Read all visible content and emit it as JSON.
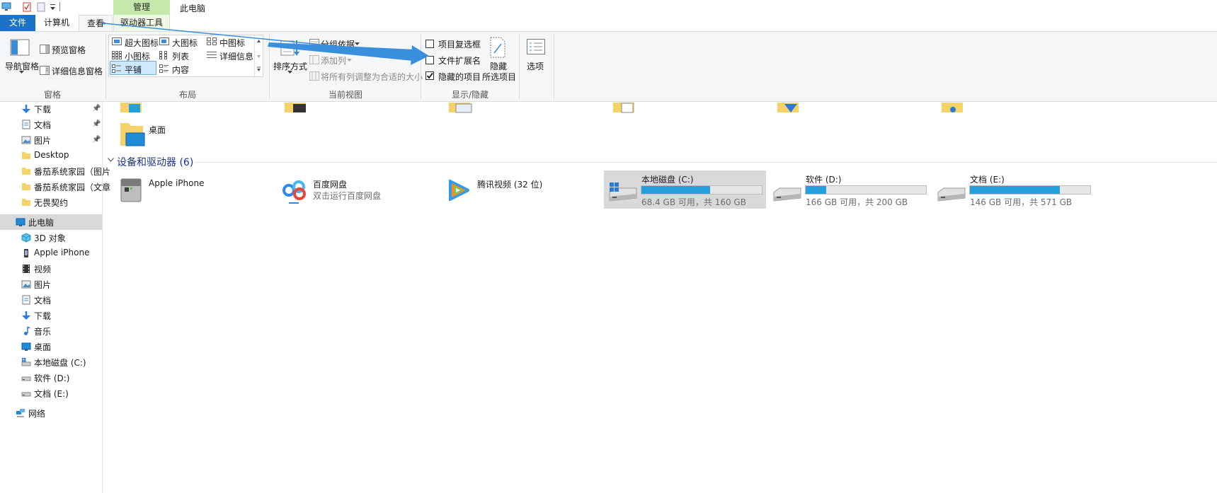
{
  "window": {
    "title": "此电脑",
    "context_header": "管理"
  },
  "tabs": {
    "file": "文件",
    "computer": "计算机",
    "view": "查看",
    "drive_tools": "驱动器工具"
  },
  "ribbon": {
    "panes": {
      "nav_pane": "导航窗格",
      "preview_pane": "预览窗格",
      "details_pane": "详细信息窗格",
      "label": "窗格"
    },
    "layout": {
      "extra_large": "超大图标",
      "large": "大图标",
      "medium": "中图标",
      "small": "小图标",
      "list": "列表",
      "details": "详细信息",
      "tiles": "平铺",
      "content": "内容",
      "label": "布局"
    },
    "current_view": {
      "sort_by": "排序方式",
      "group_by": "分组依据",
      "add_columns": "添加列",
      "size_all_columns": "将所有列调整为合适的大小",
      "label": "当前视图"
    },
    "show_hide": {
      "item_checkboxes": "项目复选框",
      "file_extensions": "文件扩展名",
      "hidden_items": "隐藏的项目",
      "hide_selected_line1": "隐藏",
      "hide_selected_line2": "所选项目",
      "label": "显示/隐藏",
      "item_checkboxes_checked": false,
      "file_extensions_checked": false,
      "hidden_items_checked": true
    },
    "options": "选项"
  },
  "nav": {
    "quick": [
      {
        "label": "下载",
        "icon": "download-icon",
        "pinned": true
      },
      {
        "label": "文档",
        "icon": "document-icon",
        "pinned": true
      },
      {
        "label": "图片",
        "icon": "picture-icon",
        "pinned": true
      },
      {
        "label": "Desktop",
        "icon": "folder-icon"
      },
      {
        "label": "番茄系统家园（图片",
        "icon": "folder-icon"
      },
      {
        "label": "番茄系统家园（文章",
        "icon": "folder-icon"
      },
      {
        "label": "无畏契约",
        "icon": "folder-icon"
      }
    ],
    "this_pc": "此电脑",
    "pc_items": [
      {
        "label": "3D 对象",
        "icon": "3d-objects-icon"
      },
      {
        "label": "Apple iPhone",
        "icon": "phone-icon"
      },
      {
        "label": "视频",
        "icon": "video-icon"
      },
      {
        "label": "图片",
        "icon": "picture-icon"
      },
      {
        "label": "文档",
        "icon": "document-icon"
      },
      {
        "label": "下载",
        "icon": "download-icon"
      },
      {
        "label": "音乐",
        "icon": "music-icon"
      },
      {
        "label": "桌面",
        "icon": "desktop-icon"
      },
      {
        "label": "本地磁盘 (C:)",
        "icon": "system-drive-icon"
      },
      {
        "label": "软件 (D:)",
        "icon": "drive-icon"
      },
      {
        "label": "文档 (E:)",
        "icon": "drive-icon"
      }
    ],
    "network": "网络"
  },
  "main": {
    "desktop_folder": "桌面",
    "devices_header": "设备和驱动器 (6)",
    "devices": [
      {
        "name": "Apple iPhone",
        "icon": "phone-device-icon"
      },
      {
        "name": "百度网盘",
        "sub": "双击运行百度网盘",
        "icon": "baidu-netdisk-icon"
      },
      {
        "name": "腾讯视频 (32 位)",
        "icon": "tencent-video-icon"
      }
    ],
    "drives": [
      {
        "name": "本地磁盘 (C:)",
        "sub": "68.4 GB 可用，共 160 GB",
        "used_fraction": 0.5725,
        "selected": true
      },
      {
        "name": "软件 (D:)",
        "sub": "166 GB 可用，共 200 GB",
        "used_fraction": 0.17
      },
      {
        "name": "文档 (E:)",
        "sub": "146 GB 可用，共 571 GB",
        "used_fraction": 0.7443
      }
    ]
  },
  "colors": {
    "accent": "#26a0da",
    "file_tab": "#1c73c5",
    "context_tab": "#c5e8ab",
    "arrow": "#3a8fdc"
  }
}
